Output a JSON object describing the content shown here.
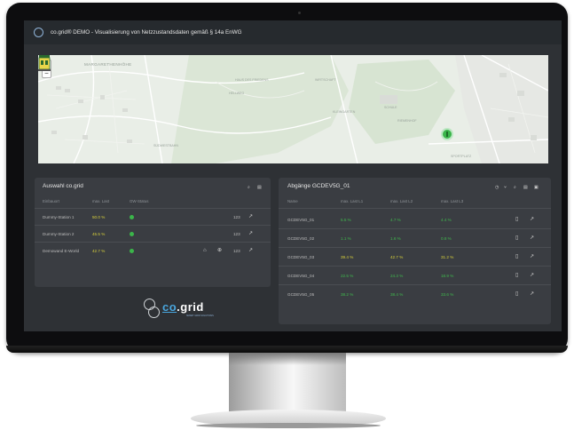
{
  "app": {
    "title": "co.grid® DEMO - Visualisierung von Netzzustandsdaten gemäß § 14a EnWG"
  },
  "map": {
    "zoom_in": "+",
    "zoom_out": "−",
    "labels": {
      "district": "MARGARETHENHÖHE",
      "l1": "HAUS DES FRIEDENS",
      "l2": "HELLWEG",
      "l3": "WIRTSCHAFT",
      "l4": "KLEINGARTEN",
      "l5": "SCHULE",
      "l6": "RIEMENHOF",
      "l7": "SÜDWESTBAHN",
      "l8": "SPORTPLATZ"
    },
    "marker_icon": "power-marker-icon",
    "station_icon": "substation-icon"
  },
  "left_panel": {
    "title": "Auswahl co.grid",
    "search_icon": "search-icon",
    "menu_icon": "menu-icon",
    "columns": [
      "Einbauort",
      "max. Last",
      "GW-Status"
    ],
    "rows": [
      {
        "name": "Dummy-Station 1",
        "load": "50.0 %",
        "load_color": "yellow",
        "status": "online",
        "count": "123"
      },
      {
        "name": "Dummy-Station 2",
        "load": "45.5 %",
        "load_color": "yellow",
        "status": "online",
        "count": "123"
      },
      {
        "name": "Demowand E-World",
        "load": "42.7 %",
        "load_color": "yellow",
        "status": "online",
        "count": "123"
      }
    ],
    "row_icons": [
      "home-icon",
      "zoom-icon",
      "trend-icon"
    ]
  },
  "brand": {
    "co": "co",
    "grid": ".grid",
    "tagline": "SMART GRID SOLUTIONS"
  },
  "right_panel": {
    "title": "Abgänge GCDEV5G_01",
    "toolbar_icons": [
      "history-icon",
      "branch-icon",
      "search-icon",
      "menu-icon",
      "export-icon"
    ],
    "columns": [
      "Name",
      "max. Last L1",
      "max. Last L2",
      "max. Last L3"
    ],
    "rows": [
      {
        "name": "GCDEV5G_01",
        "l1": "5.5 %",
        "l2": "4.7 %",
        "l3": "4.4 %"
      },
      {
        "name": "GCDEV5G_02",
        "l1": "1.1 %",
        "l2": "1.6 %",
        "l3": "0.8 %"
      },
      {
        "name": "GCDEV5G_03",
        "l1": "39.4 %",
        "l2": "42.7 %",
        "l3": "31.2 %"
      },
      {
        "name": "GCDEV5G_04",
        "l1": "22.5 %",
        "l2": "24.3 %",
        "l3": "18.9 %"
      },
      {
        "name": "GCDEV5G_05",
        "l1": "38.2 %",
        "l2": "38.4 %",
        "l3": "33.6 %"
      }
    ],
    "row_icons": [
      "meter-icon",
      "trend-icon"
    ]
  },
  "colors": {
    "screen_bg": "#2e3135",
    "panel_bg": "#3a3d42",
    "green": "#3fba4d",
    "yellow": "#d6cf3c",
    "accent_blue": "#49a6de"
  }
}
